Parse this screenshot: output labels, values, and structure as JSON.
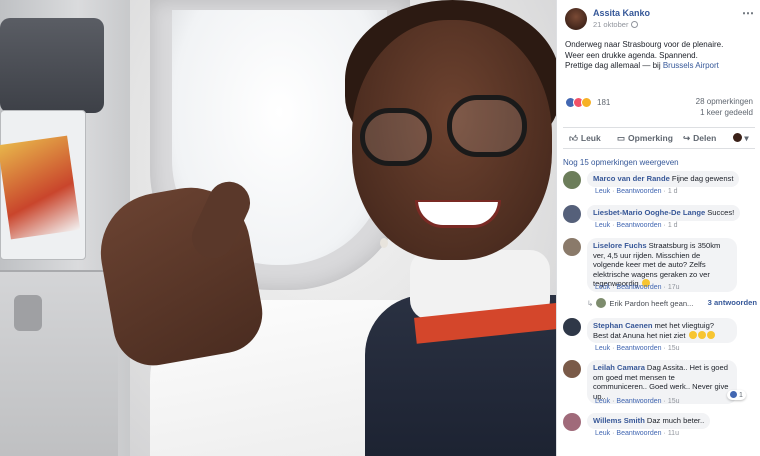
{
  "post": {
    "author": "Assita Kanko",
    "date": "21 oktober",
    "more_icon": "⋯",
    "text_lines": [
      "Onderweg naar Strasbourg voor de plenaire.",
      "Weer een drukke agenda. Spannend.",
      "Prettige dag allemaal — bij "
    ],
    "location": "Brussels Airport",
    "reaction_icons": [
      "like-icon",
      "love-icon",
      "haha-icon"
    ],
    "reaction_count": "181",
    "comments_count": "28 opmerkingen",
    "shares_count": "1 keer gedeeld"
  },
  "actions": {
    "like": "Leuk",
    "comment": "Opmerking",
    "share": "Delen",
    "audience_icon": "▾"
  },
  "more_comments": "Nog 15 opmerkingen weergeven",
  "comments": [
    {
      "name": "Marco van der Rande",
      "text": "Fijne dag gewenst",
      "like": "Leuk",
      "reply": "Beantwoorden",
      "time": "1 d"
    },
    {
      "name": "Liesbet-Mario Ooghe-De Lange",
      "text": "Succes!",
      "like": "Leuk",
      "reply": "Beantwoorden",
      "time": "1 d"
    },
    {
      "name": "Liselore Fuchs",
      "text": "Straatsburg is 350km ver, 4,5 uur rijden. Misschien de volgende keer met de auto? Zelfs elektrische wagens geraken zo ver tegenwoordig",
      "like": "Leuk",
      "reply": "Beantwoorden",
      "time": "17u"
    },
    {
      "name": "Stephan Caenen",
      "text": "met het vliegtuig? Best dat Anuna het niet ziet",
      "like": "Leuk",
      "reply": "Beantwoorden",
      "time": "15u"
    },
    {
      "name": "Leilah Camara",
      "text": "Dag Assita.. Het is goed om goed met mensen te communiceren.. Goed werk.. Never give up..",
      "like": "Leuk",
      "reply": "Beantwoorden",
      "time": "15u",
      "reactions": "1"
    },
    {
      "name": "Willems Smith",
      "text": "Daz much beter..",
      "like": "Leuk",
      "reply": "Beantwoorden",
      "time": "11u"
    }
  ],
  "reply_preview": {
    "name": "Erik Pardon heeft gean...",
    "count": "3 antwoorden"
  },
  "colors": {
    "link": "#365899",
    "like_blue": "#4267b2",
    "bubble_bg": "#f2f3f5",
    "muted": "#90949c"
  }
}
